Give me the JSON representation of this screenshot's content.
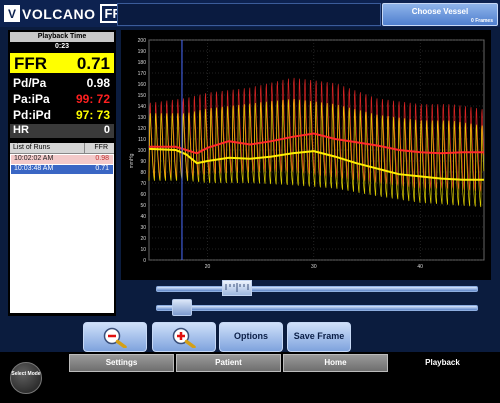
{
  "app": {
    "logo_text": "VOLCANO",
    "logo_icon": "V",
    "product": "FFR"
  },
  "vessel_button": {
    "label": "Choose Vessel",
    "frames": "0 Frames"
  },
  "playback": {
    "header": "Playback Time",
    "time": "0:23"
  },
  "metrics": {
    "ffr": {
      "label": "FFR",
      "value": "0.71"
    },
    "pdpa": {
      "label": "Pd/Pa",
      "value": "0.98",
      "color": "#ffffff"
    },
    "papa": {
      "label": "Pa:iPa",
      "value": "99: 72",
      "color": "#ff2020"
    },
    "pdipd": {
      "label": "Pd:iPd",
      "value": "97: 73",
      "color": "#ffff00"
    },
    "hr": {
      "label": "HR",
      "value": "0"
    }
  },
  "runs": {
    "header_label": "List of Runs",
    "header_value": "FFR",
    "items": [
      {
        "time": "10:02:02 AM",
        "ffr": "0.98",
        "selected": false
      },
      {
        "time": "10:03:48 AM",
        "ffr": "0.71",
        "selected": true
      }
    ]
  },
  "buttons": {
    "zoom_out_icon": "magnifier-minus-icon",
    "zoom_in_icon": "magnifier-plus-icon",
    "options": "Options",
    "save_frame": "Save Frame"
  },
  "tabs": {
    "select_mode": "Select Mode",
    "items": [
      "Settings",
      "Patient",
      "Home",
      "Playback"
    ],
    "active": "Playback"
  },
  "colors": {
    "pa_trace": "#ff2a2a",
    "pd_trace": "#ffee00",
    "cursor": "#4a6cff",
    "ffr_highlight": "#ffff00"
  },
  "chart_data": {
    "type": "line",
    "ylabel": "mmHg",
    "ylim": [
      0,
      200
    ],
    "yticks": [
      "0",
      "10",
      "20",
      "30",
      "40",
      "50",
      "60",
      "70",
      "80",
      "90",
      "100",
      "110",
      "120",
      "130",
      "140",
      "150",
      "160",
      "170",
      "180",
      "190",
      "200"
    ],
    "xticks": [
      "20",
      "30",
      "40"
    ],
    "xlim": [
      14.5,
      46
    ],
    "cursor_x": 17.6,
    "grid": true,
    "series": [
      {
        "color": "#ff2a2a",
        "style": "phasic",
        "x": [
          14.5,
          18,
          20,
          24,
          28,
          32,
          36,
          40,
          43,
          46
        ],
        "max": [
          150,
          155,
          160,
          165,
          175,
          170,
          155,
          150,
          150,
          145
        ],
        "min": [
          75,
          75,
          78,
          80,
          80,
          75,
          70,
          65,
          65,
          62
        ]
      },
      {
        "color": "#ffee00",
        "style": "phasic",
        "x": [
          14.5,
          18,
          20,
          24,
          28,
          32,
          36,
          40,
          43,
          46
        ],
        "max": [
          140,
          140,
          145,
          150,
          155,
          150,
          140,
          135,
          135,
          130
        ],
        "min": [
          72,
          72,
          70,
          70,
          68,
          65,
          58,
          52,
          50,
          48
        ]
      },
      {
        "color": "#ff2a2a",
        "style": "mean",
        "x": [
          14.5,
          17,
          18,
          19,
          20,
          22,
          24,
          26,
          28,
          30,
          32,
          34,
          36,
          38,
          40,
          42,
          44,
          46
        ],
        "y": [
          103,
          103,
          100,
          97,
          102,
          108,
          105,
          108,
          112,
          115,
          110,
          107,
          104,
          100,
          98,
          97,
          98,
          98
        ]
      },
      {
        "color": "#ffee00",
        "style": "mean",
        "x": [
          14.5,
          17,
          18,
          19,
          20,
          22,
          24,
          26,
          28,
          30,
          32,
          34,
          36,
          38,
          40,
          42,
          44,
          46
        ],
        "y": [
          101,
          100,
          96,
          88,
          90,
          93,
          92,
          94,
          97,
          99,
          94,
          88,
          83,
          78,
          76,
          74,
          73,
          73
        ]
      }
    ]
  }
}
